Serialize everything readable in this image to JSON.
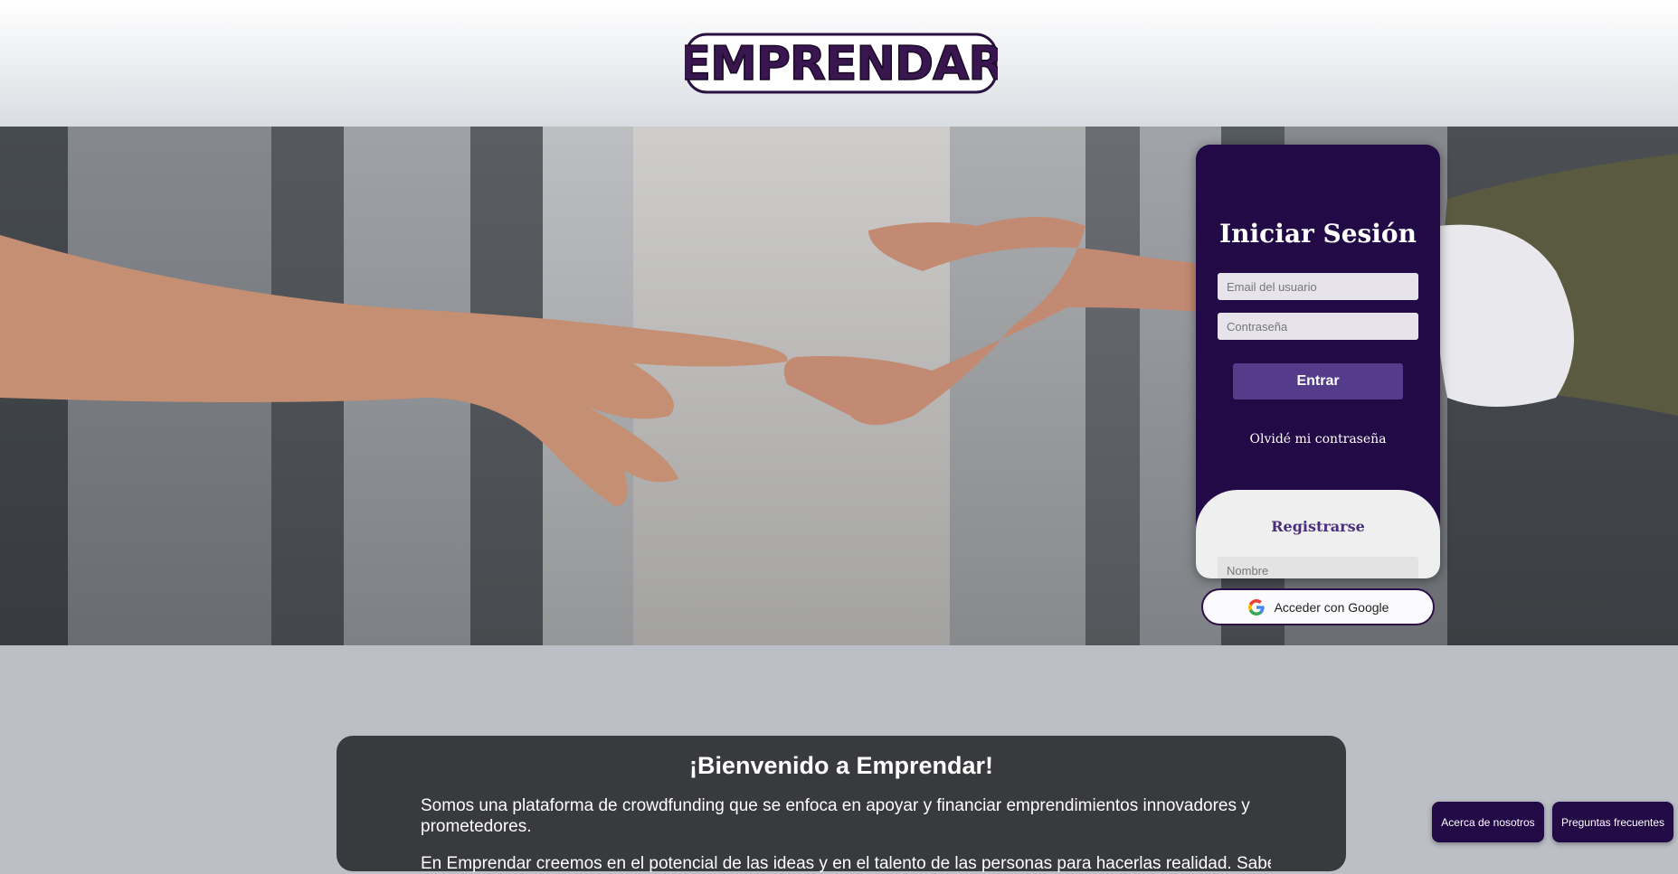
{
  "header": {
    "logo_text": "EMPRENDAR"
  },
  "login": {
    "title": "Iniciar Sesión",
    "email_placeholder": "Email del usuario",
    "password_placeholder": "Contraseña",
    "submit_label": "Entrar",
    "forgot_label": "Olvidé mi contraseña"
  },
  "register": {
    "title": "Registrarse",
    "name_placeholder": "Nombre"
  },
  "google": {
    "label": "Acceder con Google",
    "icon": "google-g-icon"
  },
  "welcome": {
    "title": "¡Bienvenido a Emprendar!",
    "paragraph1": "Somos una plataforma de crowdfunding que se enfoca en apoyar y financiar emprendimientos innovadores y prometedores.",
    "paragraph2": "En Emprendar creemos en el potencial de las ideas y en el talento de las personas para hacerlas realidad. Sabemos que"
  },
  "footer": {
    "about_label": "Acerca de nosotros",
    "faq_label": "Preguntas frecuentes"
  },
  "colors": {
    "brand_dark": "#220a47",
    "brand_button": "#553c8b",
    "welcome_bg": "#393a3d",
    "page_bg": "#bcc0c6"
  }
}
